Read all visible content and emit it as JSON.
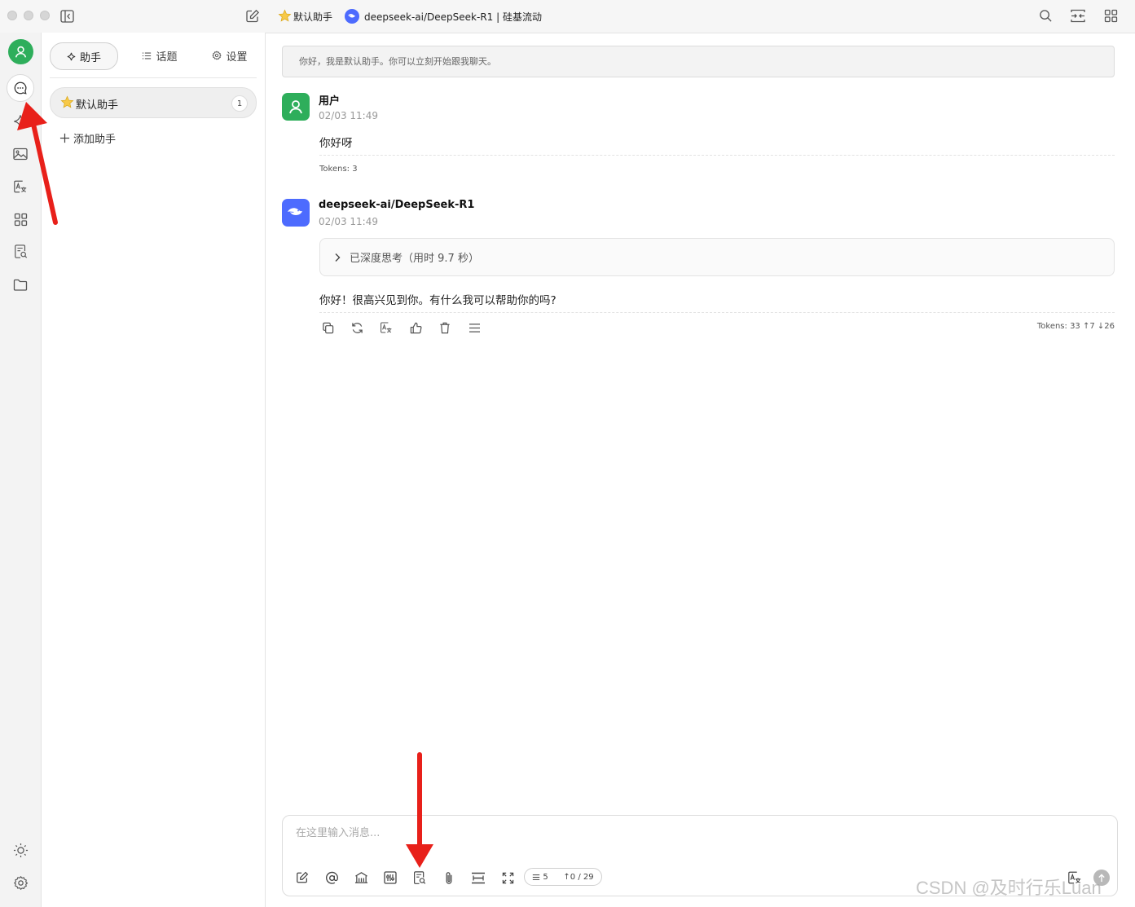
{
  "titlebar": {
    "assistant_name": "默认助手",
    "model_label": "deepseek-ai/DeepSeek-R1 | 硅基流动"
  },
  "sidebar_tabs": {
    "assistants": "助手",
    "topics": "话题",
    "settings": "设置"
  },
  "assistants": {
    "items": [
      {
        "label": "默认助手",
        "count": "1"
      }
    ],
    "add_label": "添加助手"
  },
  "chat": {
    "system_greeting": "你好，我是默认助手。你可以立刻开始跟我聊天。",
    "messages": [
      {
        "author": "用户",
        "time": "02/03 11:49",
        "content": "你好呀",
        "tokens": "Tokens: 3"
      },
      {
        "author": "deepseek-ai/DeepSeek-R1",
        "time": "02/03 11:49",
        "thinking": "已深度思考（用时 9.7 秒）",
        "content": "你好！很高兴见到你。有什么我可以帮助你的吗?",
        "tokens": "Tokens: 33 ↑7 ↓26"
      }
    ]
  },
  "input": {
    "placeholder": "在这里输入消息...",
    "context_count": "5",
    "token_count": "↑0 / 29"
  },
  "watermark": "CSDN @及时行乐Luan",
  "colors": {
    "user_avatar": "#2eae5b",
    "deepseek_avatar": "#4d6bfe",
    "annotation_arrow": "#e8201a"
  }
}
